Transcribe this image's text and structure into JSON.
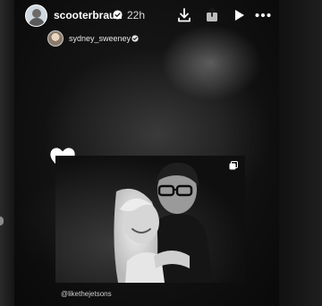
{
  "header": {
    "username": "scooterbraun",
    "time": "22h",
    "icons": {
      "verified": "verified-badge-icon",
      "download": "download-icon",
      "share": "share-icon",
      "play": "play-icon",
      "more": "more-icon"
    }
  },
  "story": {
    "repost_username": "sydney_sweeney",
    "mention": "@likethejetsons",
    "sticker": "heart-sticker-icon"
  },
  "colors": {
    "background": "#0b0b0b",
    "text": "#ffffff"
  }
}
